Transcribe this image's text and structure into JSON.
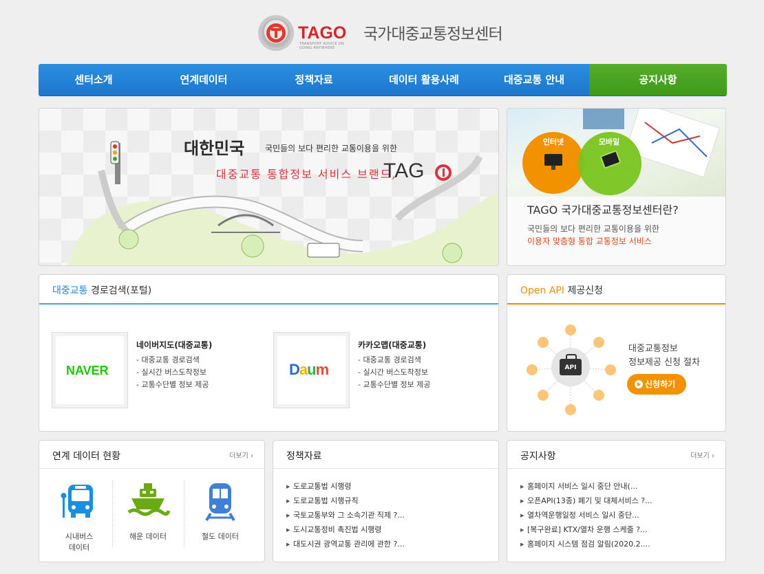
{
  "header": {
    "logo_text": "TAGO",
    "logo_subtext": "TRANSPORT ADVICE ON GOING ANYWHERE",
    "site_title": "국가대중교통정보센터"
  },
  "nav": {
    "items": [
      {
        "label": "센터소개"
      },
      {
        "label": "연계데이터"
      },
      {
        "label": "정책자료"
      },
      {
        "label": "데이터 활용사례"
      },
      {
        "label": "대중교통 안내"
      },
      {
        "label": "공지사항"
      }
    ],
    "active_color": "#4aa21f",
    "color": "#1f80d4"
  },
  "banner": {
    "line1_big": "대한민국",
    "line1_small": "국민들의 보다 편리한 교통이용을 위한",
    "line2": "대중교통 통합정보 서비스 브랜드,",
    "brand": "TAG"
  },
  "about": {
    "circle1": "인터넷",
    "circle2": "모바일",
    "title": "TAGO 국가대중교통정보센터란?",
    "desc1": "국민들의 보다 편리한 교통이용을 위한",
    "desc2": "이용자 맞춤형 통합 교통정보 서비스"
  },
  "route": {
    "title_accent": "대중교통",
    "title_rest": "경로검색(포털)",
    "services": [
      {
        "logo": "NAVER",
        "name": "네이버지도(대중교통)",
        "items": [
          "- 대중교통 경로검색",
          "- 실시간 버스도착정보",
          "- 교통수단별 정보 제공"
        ]
      },
      {
        "logo": "Daum",
        "name": "카카오맵(대중교통)",
        "items": [
          "- 대중교통 경로검색",
          "- 실시간 버스도착정보",
          "- 교통수단별 정보 제공"
        ]
      }
    ]
  },
  "openapi": {
    "title_accent": "Open API",
    "title_rest": "제공신청",
    "icon_text": "API",
    "text1": "대중교통정보",
    "text2": "정보제공 신청 절차",
    "button": "신청하기"
  },
  "data_status": {
    "title": "연계 데이터 현황",
    "more": "더보기",
    "types": [
      {
        "icon": "bus-icon",
        "label1": "시내버스",
        "label2": "데이터"
      },
      {
        "icon": "ship-icon",
        "label1": "해운 데이터",
        "label2": ""
      },
      {
        "icon": "train-icon",
        "label1": "철도 데이터",
        "label2": ""
      }
    ]
  },
  "policy": {
    "title": "정책자료",
    "items": [
      "도로교통법 시행령",
      "도로교통법 시행규칙",
      "국토교통부와 그 소속기관 직제 ?...",
      "도시교통정비 촉진법 시행령",
      "대도시권 광역교통 관리에 관한 ?..."
    ]
  },
  "notice": {
    "title": "공지사항",
    "more": "더보기",
    "items": [
      "홈페이지 서비스 일시 중단 안내(...",
      "오픈API(13종) 폐기 및 대체서비스 ?...",
      "열차역운행일정 서비스 일시 중단...",
      "[복구완료] KTX/열차 운행 스케줄 ?...",
      "홈페이지 시스템 점검 알림(2020.2...."
    ]
  }
}
